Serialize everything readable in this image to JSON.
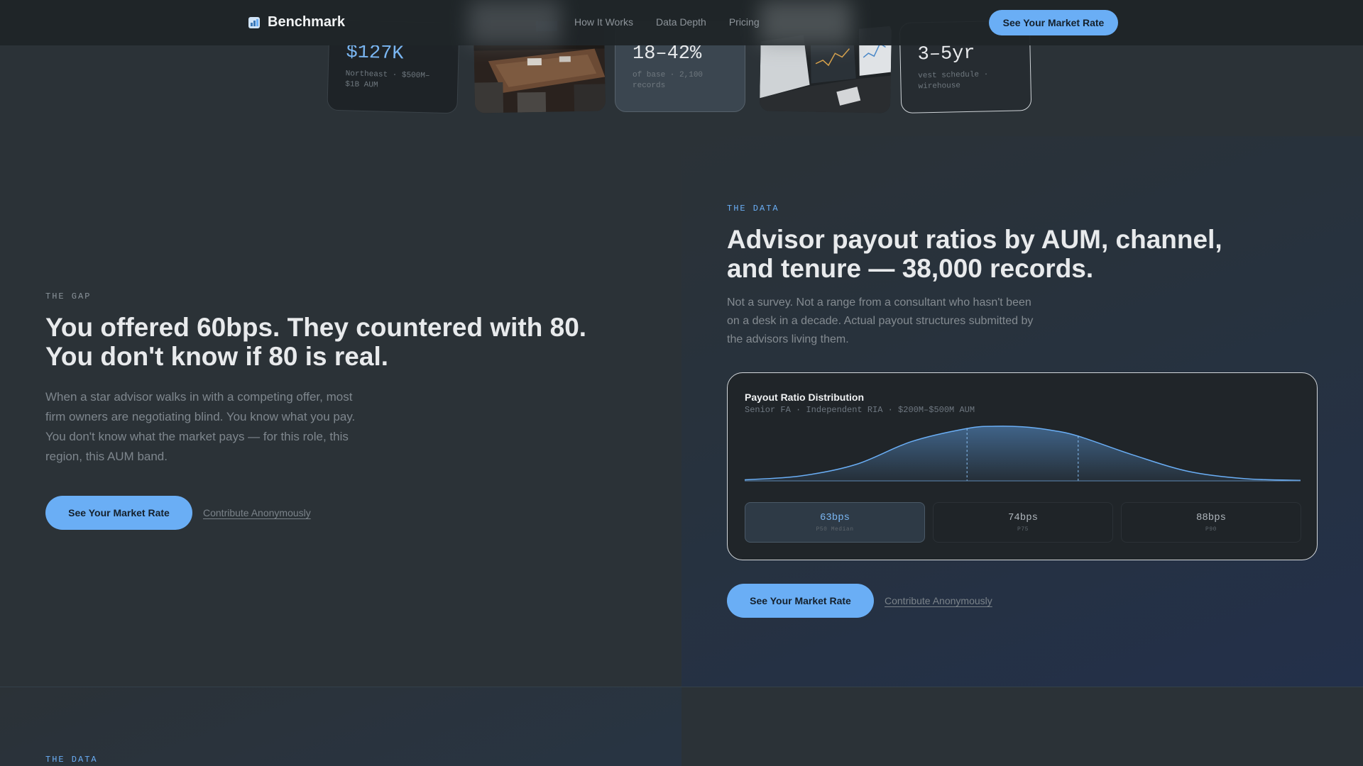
{
  "nav": {
    "brand": "Benchmark",
    "links": [
      "How It Works",
      "Data Depth",
      "Pricing"
    ],
    "cta": "See Your Market Rate"
  },
  "cards": [
    {
      "value": "$127K",
      "sub": "Northeast · $500M–$1B AUM"
    },
    {
      "value": "18–42%",
      "sub": "of base · 2,100 records"
    },
    {
      "value": "3–5yr",
      "sub": "vest schedule · wirehouse"
    }
  ],
  "gap": {
    "eyebrow": "THE GAP",
    "heading": "You offered 60bps. They countered with 80. You don't know if 80 is real.",
    "body": "When a star advisor walks in with a competing offer, most firm owners are negotiating blind. You know what you pay. You don't know what the market pays — for this role, this region, this AUM band.",
    "cta": "See Your Market Rate",
    "secondary": "Contribute Anonymously"
  },
  "data_section": {
    "eyebrow": "THE DATA",
    "heading": "Advisor payout ratios by AUM, channel, and tenure — 38,000 records.",
    "body": "Not a survey. Not a range from a consultant who hasn't been on a desk in a decade. Actual payout structures submitted by the advisors living them.",
    "cta": "See Your Market Rate",
    "secondary": "Contribute Anonymously"
  },
  "chart_data": {
    "type": "area",
    "title": "Payout Ratio Distribution",
    "subtitle": "Senior FA · Independent RIA · $200M–$500M AUM",
    "curve": {
      "x": [
        0,
        0.1,
        0.2,
        0.3,
        0.4,
        0.45,
        0.5,
        0.55,
        0.6,
        0.7,
        0.8,
        0.9,
        1.0
      ],
      "y": [
        0.02,
        0.09,
        0.3,
        0.72,
        0.96,
        1.0,
        0.99,
        0.93,
        0.82,
        0.47,
        0.17,
        0.04,
        0.01
      ]
    },
    "markers": [
      0.4,
      0.6
    ],
    "colors": {
      "accent": "#6aaef5",
      "fill": "#4a78a8"
    },
    "stats": [
      {
        "value": "63bps",
        "label": "P50 Median",
        "active": true
      },
      {
        "value": "74bps",
        "label": "P75",
        "active": false
      },
      {
        "value": "88bps",
        "label": "P90",
        "active": false
      }
    ]
  },
  "bottom": {
    "eyebrow": "THE DATA"
  }
}
